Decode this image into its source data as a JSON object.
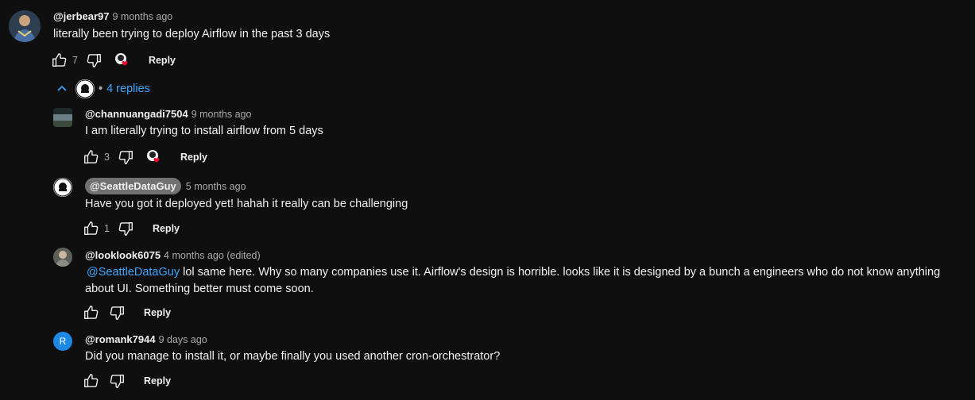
{
  "top_comment": {
    "handle": "@jerbear97",
    "time": "9 months ago",
    "text": "literally been trying to deploy Airflow in the past 3 days",
    "likes": "7",
    "reply_label": "Reply"
  },
  "replies_toggle": {
    "bullet": "•",
    "label": "4 replies"
  },
  "replies": [
    {
      "handle": "@channuangadi7504",
      "time": "9 months ago",
      "text": "I am literally trying to install airflow from 5 days",
      "likes": "3",
      "reply_label": "Reply"
    },
    {
      "handle": "@SeattleDataGuy",
      "time": "5 months ago",
      "text": "Have you got it deployed yet! hahah it really can be challenging",
      "likes": "1",
      "reply_label": "Reply"
    },
    {
      "handle": "@looklook6075",
      "time": "4 months ago (edited)",
      "mention": "@SeattleDataGuy",
      "text": " lol same here. Why so many companies use it. Airflow's design is horrible. looks like it is designed by a bunch a engineers who do not know anything about UI. Something better must come soon.",
      "reply_label": "Reply"
    },
    {
      "handle": "@romank7944",
      "time": "9 days ago",
      "avatar_letter": "R",
      "text": "Did you manage to install it, or maybe finally you used another cron-orchestrator?",
      "reply_label": "Reply"
    }
  ],
  "colors": {
    "background": "#0f0f0f",
    "link": "#3ea6ff",
    "heart": "#ff0033",
    "avatar_r": "#1e88e5"
  }
}
